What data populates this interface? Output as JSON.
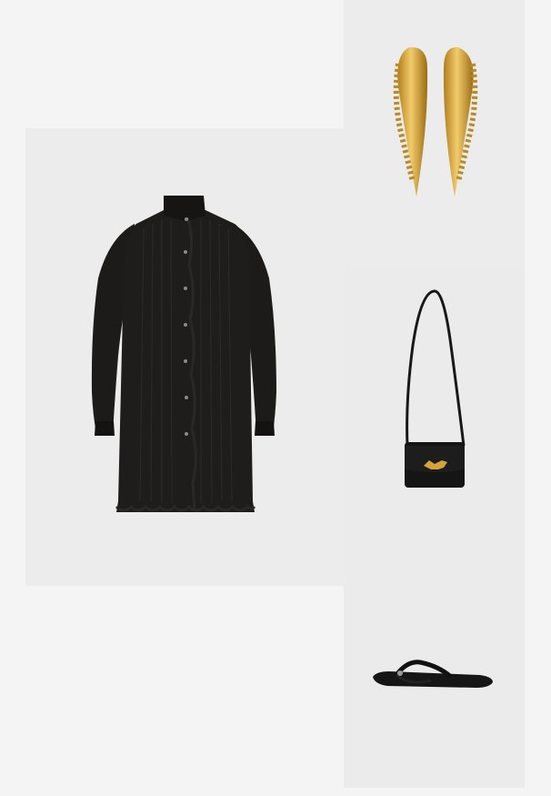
{
  "colors": {
    "page_background": "#f4f4f4",
    "panel_background": "#ececec",
    "garment": "#1b1a19",
    "gold": "#c99a2e"
  },
  "items": [
    {
      "id": "dress",
      "icon": "black-ruffled-shirt-dress-image"
    },
    {
      "id": "earrings",
      "icon": "gold-drop-earrings-image"
    },
    {
      "id": "bag",
      "icon": "black-crossbody-bag-fox-clasp-image"
    },
    {
      "id": "sandal",
      "icon": "black-thong-sandal-image"
    }
  ]
}
